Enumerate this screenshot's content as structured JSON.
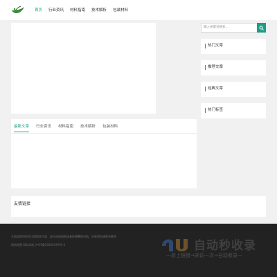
{
  "header": {
    "nav": [
      {
        "label": "首页",
        "active": true
      },
      {
        "label": "行业资讯",
        "active": false
      },
      {
        "label": "材料指南",
        "active": false
      },
      {
        "label": "技术解析",
        "active": false
      },
      {
        "label": "包装材料",
        "active": false
      }
    ]
  },
  "search": {
    "placeholder": "输入关键词搜索..."
  },
  "sidebar": {
    "widgets": [
      {
        "title": "热门文章"
      },
      {
        "title": "推荐文章"
      },
      {
        "title": "经典文章"
      },
      {
        "title": "热门标签"
      }
    ]
  },
  "main": {
    "tabs": [
      {
        "label": "最新文章",
        "active": true
      },
      {
        "label": "行业资讯",
        "active": false
      },
      {
        "label": "材料指南",
        "active": false
      },
      {
        "label": "技术解析",
        "active": false
      },
      {
        "label": "包装材料",
        "active": false
      }
    ]
  },
  "links": {
    "title": "友情链接"
  },
  "footer": {
    "line1": "本网站提供的资讯和相关内容，部分由网络和读者投稿整理归纳，如有侵权请联系删除",
    "line2": "网站地图 网站导航 沪ICP备2020XXXX号-X"
  },
  "watermark": {
    "title": "自动秒收录",
    "subtitle": "一段上链接→来访一次→自动收录一"
  },
  "colors": {
    "accent": "#1e9e86",
    "footer_bg": "#222222",
    "page_bg": "#f1f1f1"
  },
  "icons": [
    "leaf-logo-icon",
    "search-icon",
    "watermark-logo-icon"
  ]
}
